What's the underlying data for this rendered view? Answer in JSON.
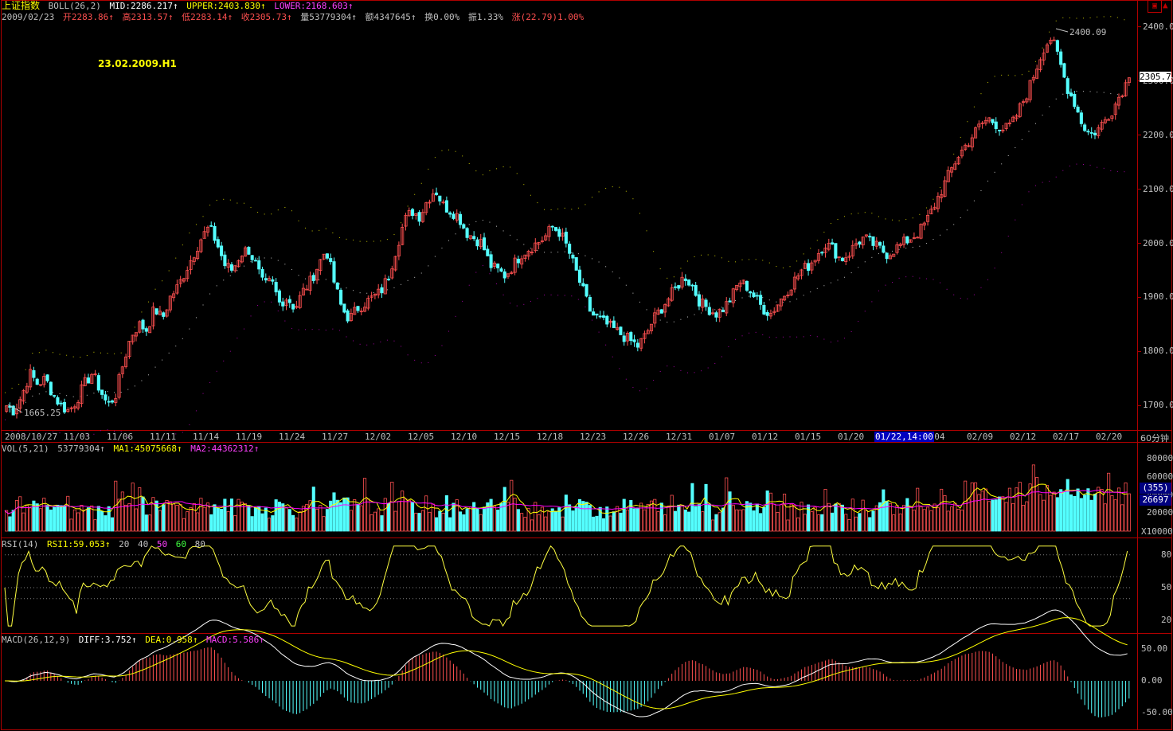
{
  "title": "上证指数",
  "boll_header": {
    "name": "BOLL(26,2)",
    "mid": "MID:2286.217",
    "upper": "UPPER:2403.830",
    "lower": "LOWER:2168.603"
  },
  "quote_header": {
    "date": "2009/02/23",
    "open": "开2283.86",
    "high": "高2313.57",
    "low": "低2283.14",
    "close": "收2305.73",
    "volume": "量53779304",
    "amount": "额4347645",
    "turnover": "换0.00%",
    "amplitude": "振1.33%",
    "change": "涨(22.79)1.00%"
  },
  "annotation": "23.02.2009.H1",
  "price_axis": {
    "ticks": [
      "2400.0",
      "2300.0",
      "2200.0",
      "2100.0",
      "2000.0",
      "1900.0",
      "1800.0",
      "1700.0"
    ],
    "tick_values": [
      2400,
      2300,
      2200,
      2100,
      2000,
      1900,
      1800,
      1700
    ],
    "range": [
      1658,
      2420
    ],
    "last_price_label": "2305.7",
    "high_marker": "2400.09",
    "low_marker": "1665.25"
  },
  "time_axis": {
    "labels": [
      "2008/10/27",
      "11/03",
      "11/06",
      "11/11",
      "11/14",
      "11/19",
      "11/24",
      "11/27",
      "12/02",
      "12/05",
      "12/10",
      "12/15",
      "12/18",
      "12/23",
      "12/26",
      "12/31",
      "01/07",
      "01/12",
      "01/15",
      "01/20",
      "01/22,14:00",
      "2/04",
      "02/09",
      "02/12",
      "02/17",
      "02/20"
    ],
    "cursor_label": "01/22,14:00",
    "period": "60分钟"
  },
  "volume_panel": {
    "header_name": "VOL(5,21)",
    "header_value": "53779304",
    "ma1": "MA1:45075668",
    "ma2": "MA2:44362312",
    "ticks": [
      "80000",
      "60000",
      "40000",
      "20000"
    ],
    "tick_values": [
      80000,
      60000,
      40000,
      20000
    ],
    "badge1": "(355)",
    "badge2": "26697",
    "unit": "X10000"
  },
  "rsi_panel": {
    "header_name": "RSI(14)",
    "rsi1": "RSI1:59.053",
    "levels_text": [
      "20",
      "40",
      "50",
      "60",
      "80"
    ],
    "ticks": [
      "80",
      "50",
      "20"
    ],
    "tick_values": [
      80,
      50,
      20
    ]
  },
  "macd_panel": {
    "header_name": "MACD(26,12,9)",
    "diff": "DIFF:3.752",
    "dea": "DEA:0.958",
    "macd": "MACD:5.586",
    "ticks": [
      "50.00",
      "0.00",
      "-50.00"
    ],
    "tick_values": [
      50,
      0,
      -50
    ]
  },
  "colors": {
    "up": "#ff5050",
    "down": "#54ffff",
    "frame": "#b00000",
    "mid_band": "#c0c0c0",
    "upper_band": "#c0c000",
    "lower_band": "#a000a0",
    "ma1": "#ffff00",
    "ma2": "#ff00ff",
    "rsi": "#ffff40",
    "diff": "#ffffff",
    "dea": "#ffff00"
  },
  "chart_data": {
    "type": "candlestick",
    "title": "上证指数",
    "ylim": [
      1658,
      2420
    ],
    "close_path": [
      1700,
      1690,
      1720,
      1760,
      1740,
      1750,
      1720,
      1700,
      1690,
      1710,
      1740,
      1760,
      1730,
      1700,
      1720,
      1780,
      1830,
      1850,
      1840,
      1880,
      1860,
      1900,
      1920,
      1950,
      1980,
      2010,
      2030,
      2000,
      1960,
      1950,
      1980,
      1990,
      1960,
      1920,
      1930,
      1890,
      1900,
      1880,
      1910,
      1930,
      1960,
      1990,
      1930,
      1880,
      1860,
      1880,
      1890,
      1900,
      1910,
      1940,
      1990,
      2040,
      2060,
      2050,
      2080,
      2100,
      2070,
      2060,
      2050,
      2020,
      2010,
      2000,
      1960,
      1950,
      1940,
      1960,
      1980,
      1990,
      2000,
      2010,
      2030,
      2020,
      1990,
      1950,
      1910,
      1870,
      1860,
      1850,
      1840,
      1830,
      1820,
      1810,
      1830,
      1860,
      1880,
      1900,
      1920,
      1940,
      1920,
      1890,
      1880,
      1870,
      1880,
      1900,
      1930,
      1920,
      1900,
      1880,
      1870,
      1890,
      1910,
      1930,
      1950,
      1960,
      1980,
      2000,
      1990,
      1970,
      1980,
      2000,
      2010,
      2000,
      1990,
      1980,
      1990,
      2000,
      2010,
      2020,
      2040,
      2070,
      2100,
      2130,
      2160,
      2180,
      2200,
      2220,
      2230,
      2220,
      2210,
      2220,
      2250,
      2280,
      2320,
      2360,
      2380,
      2340,
      2290,
      2260,
      2220,
      2200,
      2210,
      2230,
      2250,
      2280,
      2305
    ]
  }
}
